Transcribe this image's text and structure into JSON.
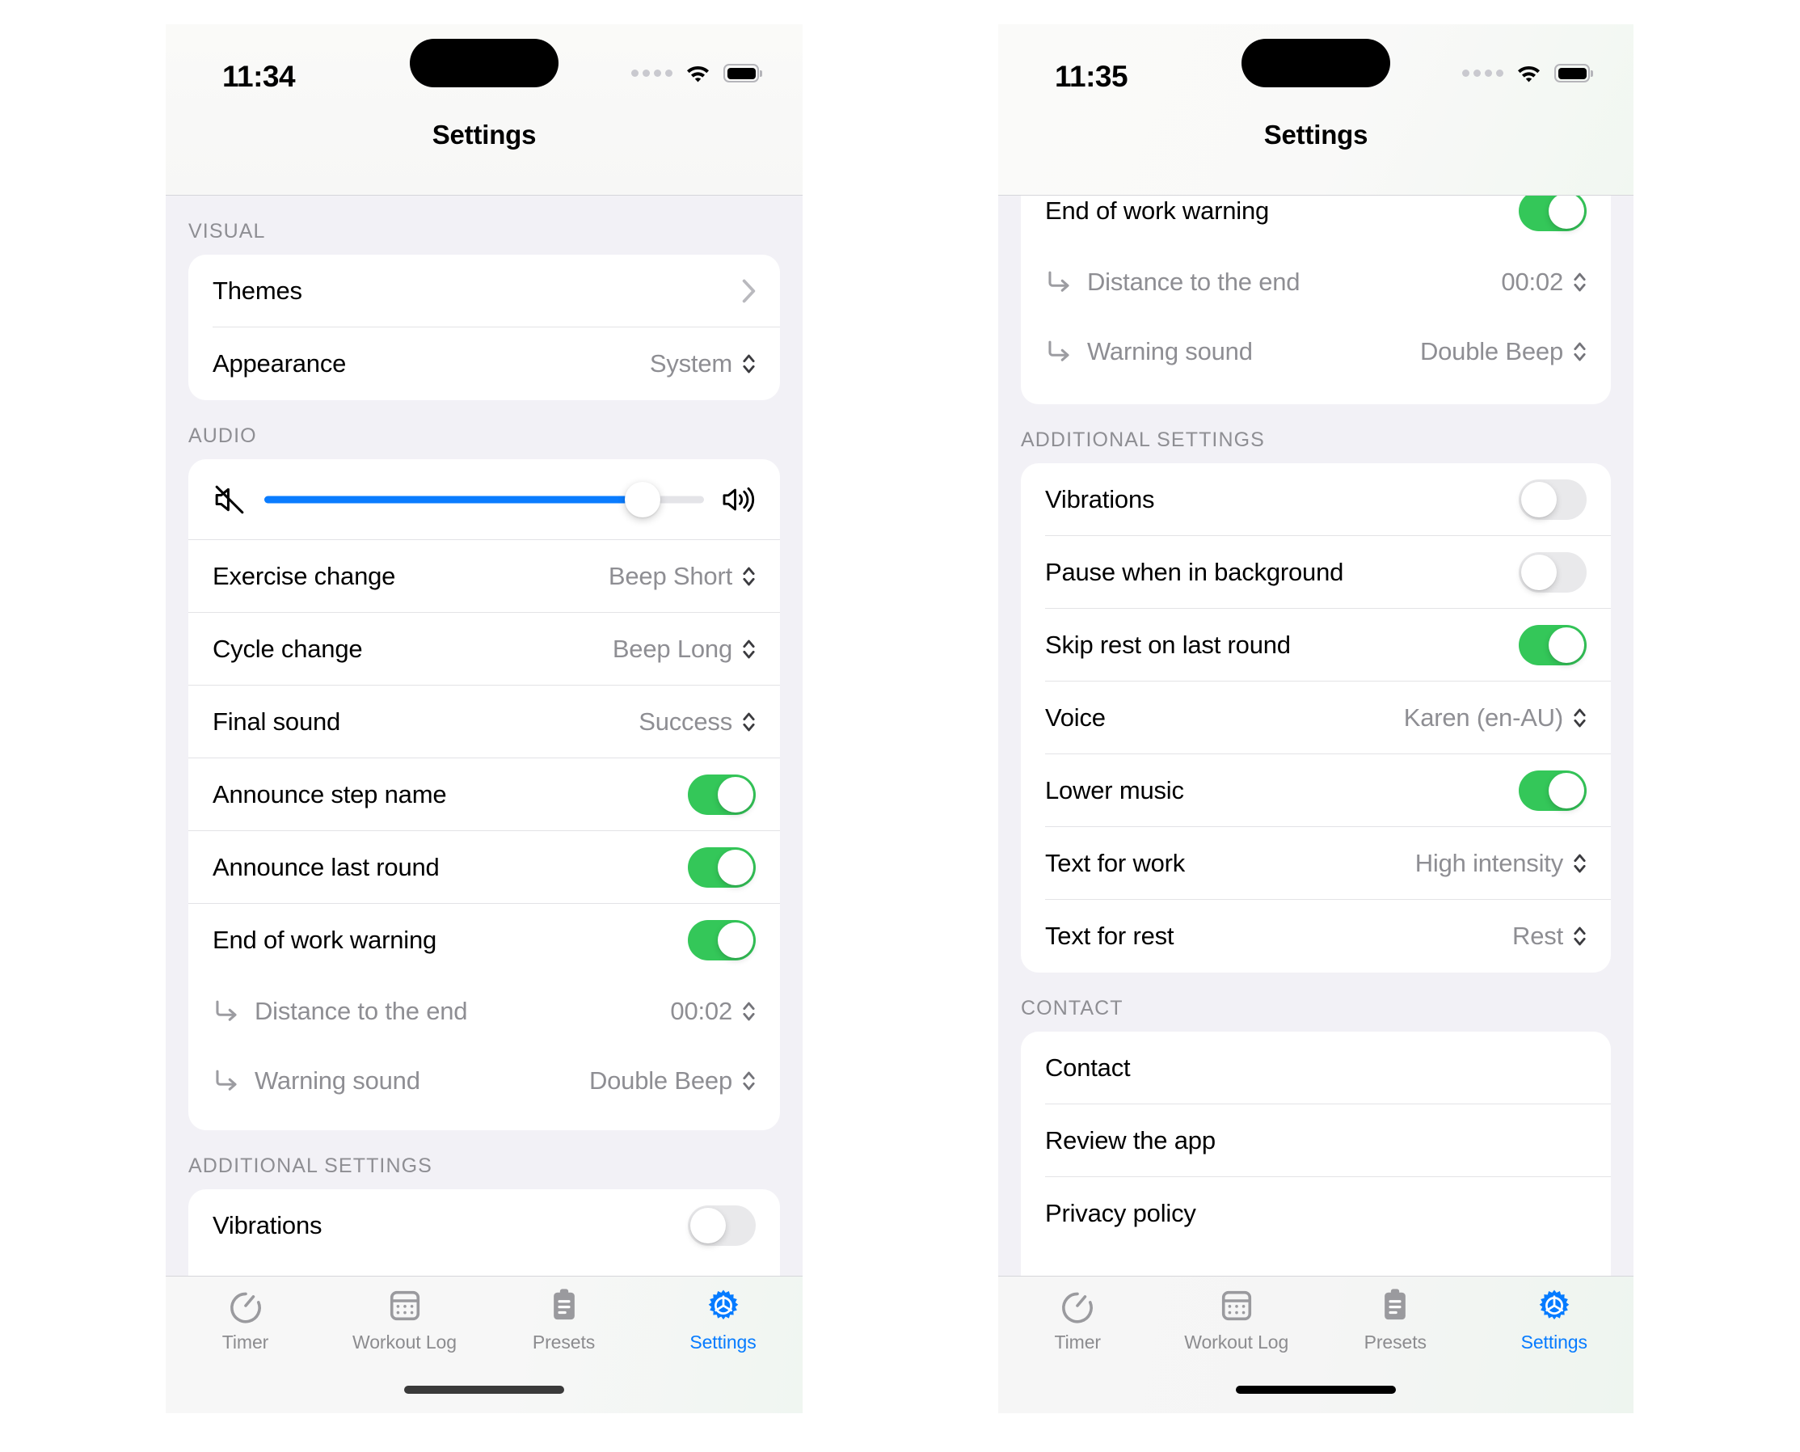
{
  "left_phone": {
    "status": {
      "time": "11:34",
      "wifi_icon": "wifi-icon",
      "battery_icon": "battery-icon",
      "cellular_icon": "cellular-dots-icon"
    },
    "nav_title": "Settings",
    "sections": [
      {
        "header": "VISUAL",
        "rows": [
          {
            "label": "Themes",
            "type": "disclosure",
            "icon": "chevron-right-icon",
            "divider": true
          },
          {
            "label": "Appearance",
            "type": "picker",
            "value": "System",
            "icon": "up-down-chevron-icon",
            "divider": false
          }
        ]
      },
      {
        "header": "AUDIO",
        "rows": [
          {
            "label": "Volume",
            "type": "slider",
            "value": "86",
            "left_icon": "speaker-mute-icon",
            "right_icon": "speaker-wave-icon",
            "divider": true
          },
          {
            "label": "Exercise change",
            "type": "picker",
            "value": "Beep Short",
            "icon": "up-down-chevron-icon",
            "divider": true
          },
          {
            "label": "Cycle change",
            "type": "picker",
            "value": "Beep Long",
            "icon": "up-down-chevron-icon",
            "divider": true
          },
          {
            "label": "Final sound",
            "type": "picker",
            "value": "Success",
            "icon": "up-down-chevron-icon",
            "divider": true
          },
          {
            "label": "Announce step name",
            "type": "toggle",
            "value": "on",
            "divider": true
          },
          {
            "label": "Announce last round",
            "type": "toggle",
            "value": "on",
            "divider": true
          },
          {
            "label": "End of work warning",
            "type": "toggle",
            "value": "on",
            "divider": false
          },
          {
            "label": "Distance to the end",
            "type": "picker",
            "value": "00:02",
            "sub": true,
            "icon": "up-down-chevron-icon",
            "sub_icon": "arrow-turn-down-right-icon",
            "divider": false
          },
          {
            "label": "Warning sound",
            "type": "picker",
            "value": "Double Beep",
            "sub": true,
            "icon": "up-down-chevron-icon",
            "sub_icon": "arrow-turn-down-right-icon",
            "divider": false
          }
        ]
      },
      {
        "header": "ADDITIONAL SETTINGS",
        "rows": [
          {
            "label": "Vibrations",
            "type": "toggle",
            "value": "off",
            "divider": false
          }
        ]
      }
    ],
    "tabs": [
      {
        "label": "Timer",
        "icon": "stopwatch-icon",
        "active": false
      },
      {
        "label": "Workout Log",
        "icon": "calendar-icon",
        "active": false
      },
      {
        "label": "Presets",
        "icon": "clipboard-icon",
        "active": false
      },
      {
        "label": "Settings",
        "icon": "gear-icon",
        "active": true
      }
    ]
  },
  "right_phone": {
    "status": {
      "time": "11:35",
      "wifi_icon": "wifi-icon",
      "battery_icon": "battery-icon",
      "cellular_icon": "cellular-dots-icon"
    },
    "nav_title": "Settings",
    "sections": [
      {
        "header": "",
        "rows": [
          {
            "label": "End of work warning",
            "type": "toggle",
            "value": "on",
            "clipped": true,
            "divider": false
          },
          {
            "label": "Distance to the end",
            "type": "picker",
            "value": "00:02",
            "sub": true,
            "icon": "up-down-chevron-icon",
            "sub_icon": "arrow-turn-down-right-icon",
            "divider": false
          },
          {
            "label": "Warning sound",
            "type": "picker",
            "value": "Double Beep",
            "sub": true,
            "icon": "up-down-chevron-icon",
            "sub_icon": "arrow-turn-down-right-icon",
            "divider": false
          }
        ]
      },
      {
        "header": "ADDITIONAL SETTINGS",
        "rows": [
          {
            "label": "Vibrations",
            "type": "toggle",
            "value": "off",
            "divider": true
          },
          {
            "label": "Pause when in background",
            "type": "toggle",
            "value": "off",
            "divider": true
          },
          {
            "label": "Skip rest on last round",
            "type": "toggle",
            "value": "on",
            "divider": true
          },
          {
            "label": "Voice",
            "type": "picker",
            "value": "Karen (en-AU)",
            "icon": "up-down-chevron-icon",
            "divider": true
          },
          {
            "label": "Lower music",
            "type": "toggle",
            "value": "on",
            "divider": true
          },
          {
            "label": "Text for work",
            "type": "picker",
            "value": "High intensity",
            "icon": "up-down-chevron-icon",
            "divider": true
          },
          {
            "label": "Text for rest",
            "type": "picker",
            "value": "Rest",
            "icon": "up-down-chevron-icon",
            "divider": false
          }
        ]
      },
      {
        "header": "CONTACT",
        "rows": [
          {
            "label": "Contact",
            "type": "plain",
            "divider": true
          },
          {
            "label": "Review the app",
            "type": "plain",
            "divider": true
          },
          {
            "label": "Privacy policy",
            "type": "plain",
            "divider": false
          }
        ]
      }
    ],
    "tabs": [
      {
        "label": "Timer",
        "icon": "stopwatch-icon",
        "active": false
      },
      {
        "label": "Workout Log",
        "icon": "calendar-icon",
        "active": false
      },
      {
        "label": "Presets",
        "icon": "clipboard-icon",
        "active": false
      },
      {
        "label": "Settings",
        "icon": "gear-icon",
        "active": true
      }
    ]
  },
  "colors": {
    "accent_blue": "#067bff",
    "toggle_on_green": "#34c759",
    "toggle_off_gray": "#e9e9eb",
    "slider_blue": "#0a7cff",
    "secondary_text": "#8e8e93",
    "group_bg": "#f2f1f6"
  }
}
